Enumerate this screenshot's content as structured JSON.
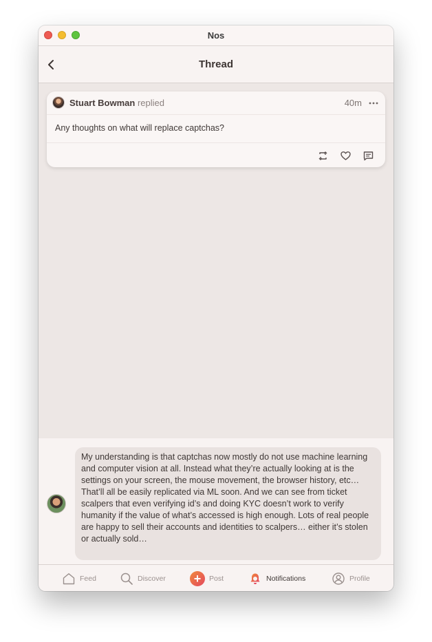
{
  "window": {
    "title": "Nos"
  },
  "nav": {
    "title": "Thread"
  },
  "note": {
    "author": "Stuart Bowman",
    "action": "replied",
    "time": "40m",
    "content": "Any thoughts on what will replace captchas?"
  },
  "reply": {
    "content": "My understanding is that captchas now mostly do not use machine learning and computer vision at all. Instead what they’re actually looking at is the settings on your screen, the mouse movement, the browser history, etc… That’ll all be easily replicated via ML soon. And we can see from ticket scalpers that even verifying id’s and doing KYC doesn’t work to verify humanity if the value of what’s accessed is high enough. Lots of real people are happy to sell their accounts and identities to scalpers… either it’s stolen or actually sold…"
  },
  "tabs": [
    {
      "label": "Feed",
      "icon": "home-icon"
    },
    {
      "label": "Discover",
      "icon": "search-icon"
    },
    {
      "label": "Post",
      "icon": "plus-icon"
    },
    {
      "label": "Notifications",
      "icon": "bell-icon"
    },
    {
      "label": "Profile",
      "icon": "person-icon"
    }
  ],
  "colors": {
    "accent_start": "#f08a3c",
    "accent_end": "#e4485e",
    "background": "#ede7e5"
  }
}
